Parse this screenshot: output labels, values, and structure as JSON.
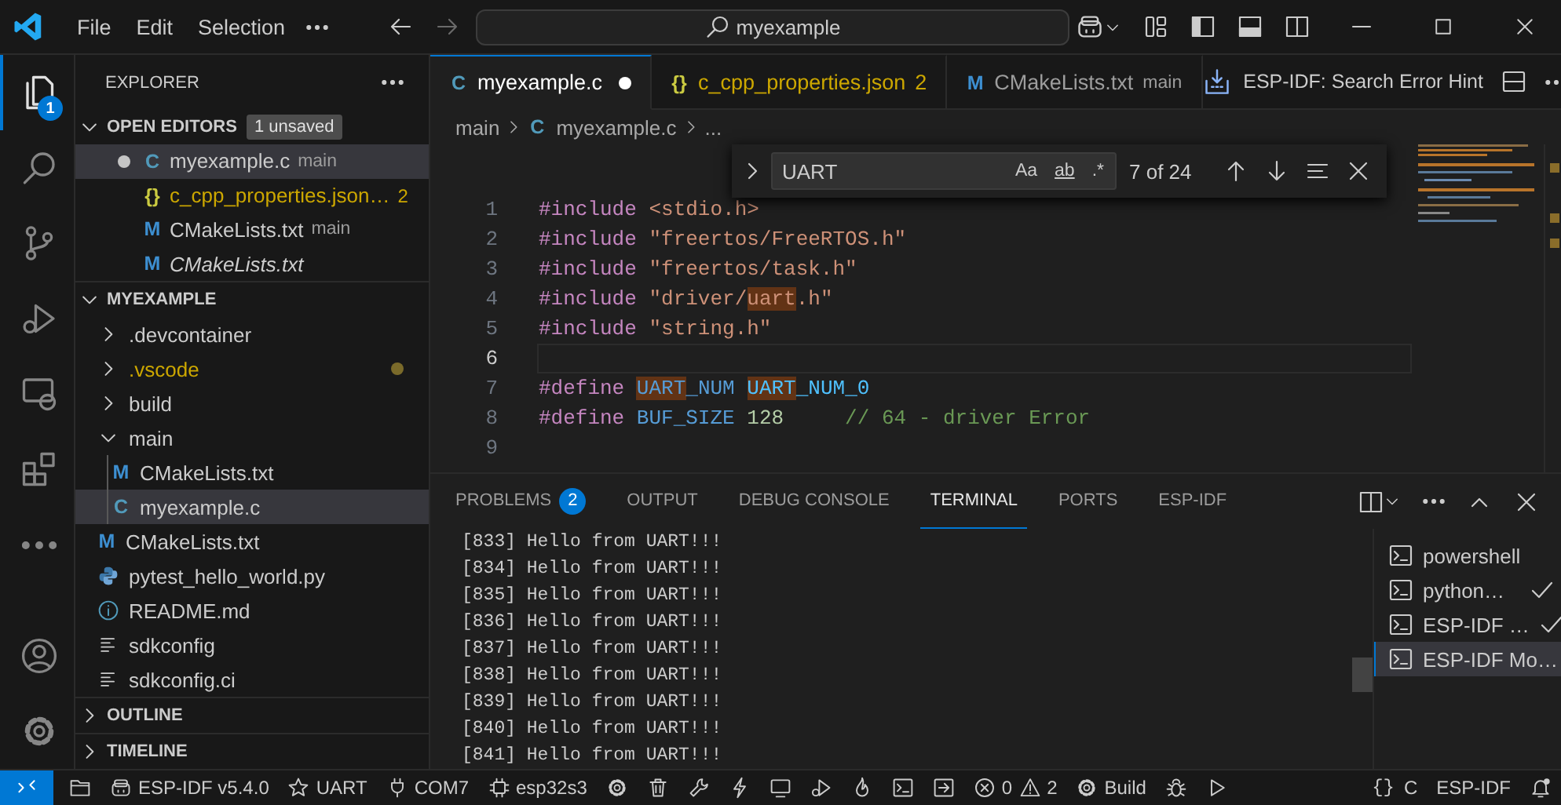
{
  "title_bar": {
    "menu": [
      {
        "label": "File"
      },
      {
        "label": "Edit"
      },
      {
        "label": "Selection"
      }
    ],
    "search": {
      "value": "myexample"
    }
  },
  "activity_bar": {
    "items": [
      {
        "kind": "files",
        "selected": true,
        "badge": "1"
      },
      {
        "kind": "search",
        "selected": false
      },
      {
        "kind": "source-control",
        "selected": false
      },
      {
        "kind": "run-debug",
        "selected": false
      },
      {
        "kind": "remote-explorer",
        "selected": false
      },
      {
        "kind": "extensions",
        "selected": false
      },
      {
        "kind": "more",
        "selected": false
      }
    ],
    "bottom": [
      {
        "kind": "account"
      },
      {
        "kind": "settings"
      }
    ]
  },
  "sidebar": {
    "title": "EXPLORER",
    "open_editors": {
      "title": "OPEN EDITORS",
      "expanded": true,
      "badge": "1 unsaved",
      "items": [
        {
          "kind": "c",
          "glyph": "C",
          "name": "myexample.c",
          "detail": "main",
          "warning": false,
          "preview": false,
          "dirty": true,
          "selected": true
        },
        {
          "kind": "json",
          "glyph": "{}",
          "name": "c_cpp_properties.json…",
          "badge": "2",
          "warning": true,
          "preview": false,
          "dirty": false,
          "selected": false
        },
        {
          "kind": "cmake",
          "glyph": "M",
          "name": "CMakeLists.txt",
          "detail": "main",
          "warning": false,
          "preview": false,
          "dirty": false,
          "selected": false
        },
        {
          "kind": "cmake",
          "glyph": "M",
          "name": "CMakeLists.txt",
          "warning": false,
          "preview": true,
          "dirty": false,
          "selected": false
        }
      ]
    },
    "folder": {
      "title": "MYEXAMPLE",
      "expanded": true,
      "tree": [
        {
          "kind": "folder",
          "name": ".devcontainer",
          "expanded": false,
          "warning": false,
          "selected": false
        },
        {
          "kind": "folder",
          "name": ".vscode",
          "expanded": false,
          "warning": true,
          "selected": false
        },
        {
          "kind": "folder",
          "name": "build",
          "expanded": false,
          "warning": false,
          "selected": false
        },
        {
          "kind": "folder",
          "name": "main",
          "expanded": true,
          "warning": false,
          "selected": false,
          "children": [
            {
              "kind": "cmake",
              "glyph": "M",
              "name": "CMakeLists.txt",
              "selected": false
            },
            {
              "kind": "c",
              "glyph": "C",
              "name": "myexample.c",
              "selected": true
            }
          ]
        },
        {
          "kind": "cmake",
          "glyph": "M",
          "name": "CMakeLists.txt",
          "selected": false
        },
        {
          "kind": "python",
          "name": "pytest_hello_world.py",
          "selected": false
        },
        {
          "kind": "info",
          "name": "README.md",
          "selected": false
        },
        {
          "kind": "config",
          "name": "sdkconfig",
          "selected": false
        },
        {
          "kind": "config",
          "name": "sdkconfig.ci",
          "selected": false
        }
      ]
    },
    "sections": [
      {
        "title": "OUTLINE",
        "expanded": false
      },
      {
        "title": "TIMELINE",
        "expanded": false
      }
    ]
  },
  "editor": {
    "tabs": [
      {
        "kind": "c",
        "glyph": "C",
        "label": "myexample.c",
        "warning": false,
        "dirty": true,
        "selected": true
      },
      {
        "kind": "json",
        "glyph": "{}",
        "label": "c_cpp_properties.json",
        "badge": "2",
        "warning": true,
        "dirty": false,
        "selected": false
      },
      {
        "kind": "cmake",
        "glyph": "M",
        "label": "CMakeLists.txt",
        "detail": "main",
        "warning": false,
        "dirty": false,
        "selected": false
      }
    ],
    "action": {
      "label": "ESP-IDF: Search Error Hint"
    },
    "breadcrumb": [
      {
        "label": "main"
      },
      {
        "kind": "c",
        "glyph": "C",
        "label": "myexample.c"
      },
      {
        "label": "..."
      }
    ],
    "find": {
      "value": "UART",
      "options": [
        {
          "label": "Aa",
          "on": false
        },
        {
          "label": "ab",
          "on": false
        },
        {
          "label": ".*",
          "on": false
        }
      ],
      "result": "7 of 24"
    },
    "lines": [
      {
        "number": "1",
        "current": false,
        "tokens": [
          {
            "kind": "directive",
            "text": "#include "
          },
          {
            "kind": "string",
            "text": "<stdio.h>"
          }
        ]
      },
      {
        "number": "2",
        "current": false,
        "tokens": [
          {
            "kind": "directive",
            "text": "#include "
          },
          {
            "kind": "string",
            "text": "\"freertos/FreeRTOS.h\""
          }
        ]
      },
      {
        "number": "3",
        "current": false,
        "tokens": [
          {
            "kind": "directive",
            "text": "#include "
          },
          {
            "kind": "string",
            "text": "\"freertos/task.h\""
          }
        ]
      },
      {
        "number": "4",
        "current": false,
        "tokens": [
          {
            "kind": "directive",
            "text": "#include "
          },
          {
            "kind": "string",
            "text": "\"driver/"
          },
          {
            "kind": "string",
            "text": "uart",
            "match": true
          },
          {
            "kind": "string",
            "text": ".h\""
          }
        ]
      },
      {
        "number": "5",
        "current": false,
        "tokens": [
          {
            "kind": "directive",
            "text": "#include "
          },
          {
            "kind": "string",
            "text": "\"string.h\""
          }
        ]
      },
      {
        "number": "6",
        "current": true
      },
      {
        "number": "7",
        "current": false,
        "tokens": [
          {
            "kind": "directive",
            "text": "#define "
          },
          {
            "kind": "macro",
            "text": "UART",
            "match": true
          },
          {
            "kind": "macro",
            "text": "_NUM "
          },
          {
            "kind": "constant",
            "text": "UART",
            "match": true
          },
          {
            "kind": "constant",
            "text": "_NUM_0"
          }
        ]
      },
      {
        "number": "8",
        "current": false,
        "tokens": [
          {
            "kind": "directive",
            "text": "#define "
          },
          {
            "kind": "macro",
            "text": "BUF_SIZE "
          },
          {
            "kind": "number",
            "text": "128"
          },
          {
            "kind": "comment",
            "text": "     // 64 - driver Error"
          }
        ]
      },
      {
        "number": "9",
        "current": false
      }
    ]
  },
  "panel": {
    "tabs": [
      {
        "label": "PROBLEMS",
        "badge": "2",
        "selected": false
      },
      {
        "label": "OUTPUT",
        "selected": false
      },
      {
        "label": "DEBUG CONSOLE",
        "selected": false
      },
      {
        "label": "TERMINAL",
        "selected": true
      },
      {
        "label": "PORTS",
        "selected": false
      },
      {
        "label": "ESP-IDF",
        "selected": false
      }
    ],
    "terminal_lines": [
      "[833] Hello from UART!!!",
      "[834] Hello from UART!!!",
      "[835] Hello from UART!!!",
      "[836] Hello from UART!!!",
      "[837] Hello from UART!!!",
      "[838] Hello from UART!!!",
      "[839] Hello from UART!!!",
      "[840] Hello from UART!!!",
      "[841] Hello from UART!!!"
    ],
    "terminals": [
      {
        "name": "powershell",
        "done": false,
        "selected": false
      },
      {
        "name": "python…",
        "done": true,
        "selected": false
      },
      {
        "name": "ESP-IDF …",
        "done": true,
        "selected": false
      },
      {
        "name": "ESP-IDF Mo…",
        "done": false,
        "selected": true
      }
    ]
  },
  "status_bar": {
    "left": [
      {
        "kind": "remote"
      },
      {
        "kind": "folder"
      },
      {
        "kind": "robot",
        "text": "ESP-IDF v5.4.0"
      },
      {
        "kind": "star",
        "text": "UART"
      },
      {
        "kind": "plug",
        "text": "COM7"
      },
      {
        "kind": "chip",
        "text": "esp32s3"
      },
      {
        "kind": "gear"
      },
      {
        "kind": "trash"
      },
      {
        "kind": "wrench"
      },
      {
        "kind": "flash"
      },
      {
        "kind": "monitor"
      },
      {
        "kind": "debug"
      },
      {
        "kind": "flame"
      },
      {
        "kind": "terminal"
      },
      {
        "kind": "arrow-box"
      },
      {
        "kind": "problems",
        "errors": "0",
        "warnings": "2"
      },
      {
        "kind": "gear",
        "text": "Build"
      },
      {
        "kind": "bug"
      },
      {
        "kind": "play"
      }
    ],
    "right": [
      {
        "glyph": "{}",
        "text": "C"
      },
      {
        "text": "ESP-IDF"
      },
      {
        "kind": "bell"
      }
    ]
  }
}
